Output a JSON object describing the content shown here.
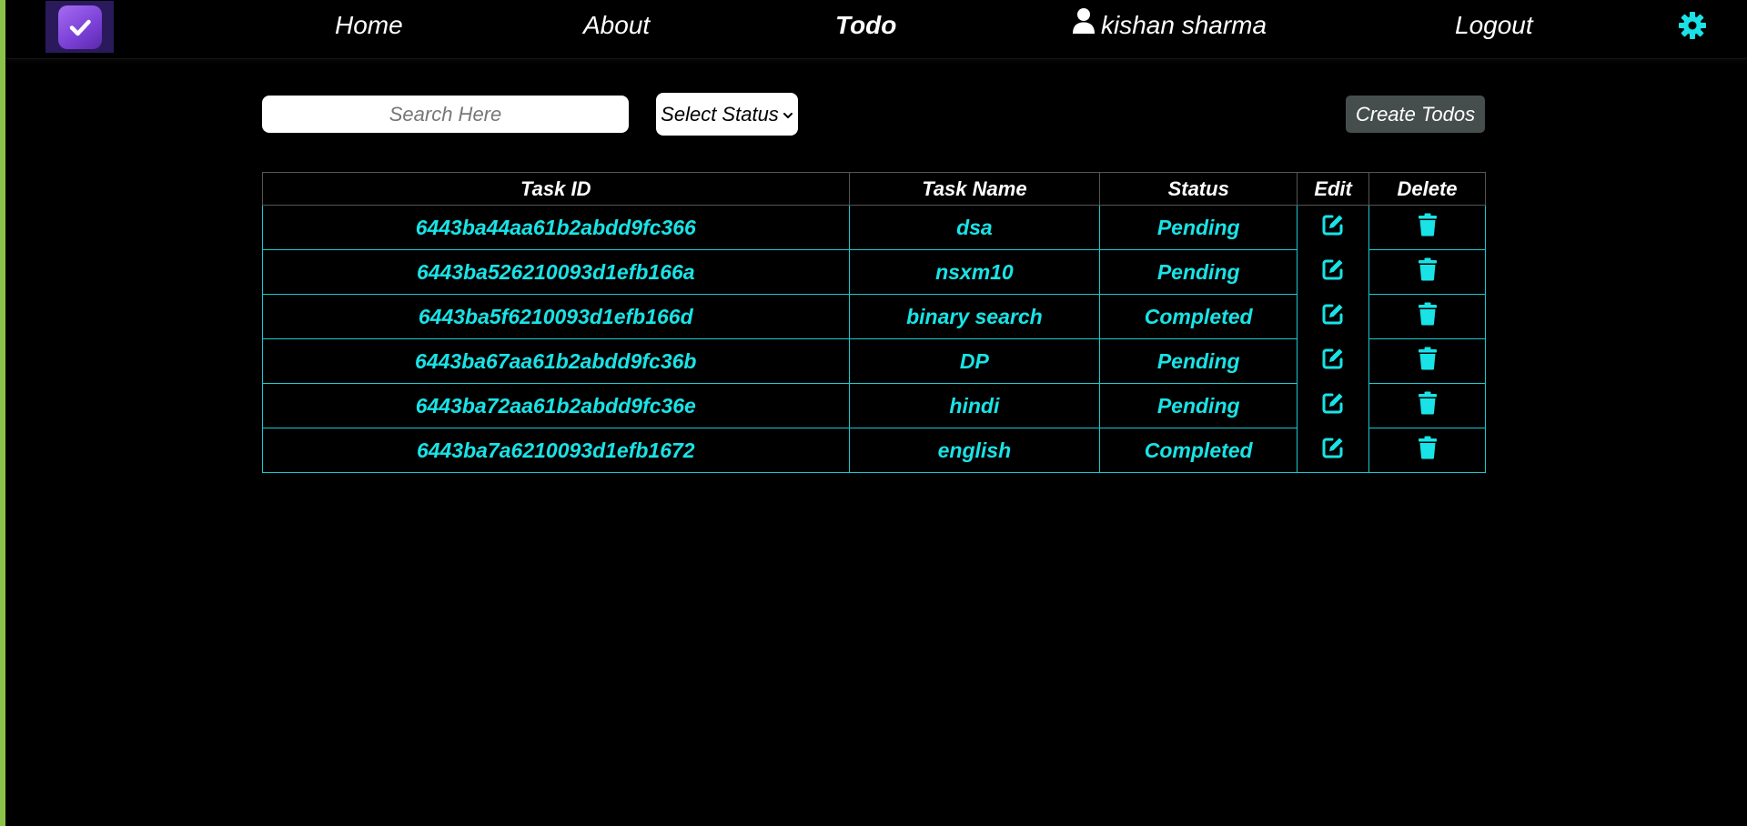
{
  "nav": {
    "home": "Home",
    "about": "About",
    "todo": "Todo",
    "user": "kishan sharma",
    "logout": "Logout"
  },
  "toolbar": {
    "search_placeholder": "Search Here",
    "status_select": "Select Status",
    "create_button": "Create Todos"
  },
  "table": {
    "headers": {
      "id": "Task ID",
      "name": "Task Name",
      "status": "Status",
      "edit": "Edit",
      "delete": "Delete"
    },
    "rows": [
      {
        "id": "6443ba44aa61b2abdd9fc366",
        "name": "dsa",
        "status": "Pending"
      },
      {
        "id": "6443ba526210093d1efb166a",
        "name": "nsxm10",
        "status": "Pending"
      },
      {
        "id": "6443ba5f6210093d1efb166d",
        "name": "binary search",
        "status": "Completed"
      },
      {
        "id": "6443ba67aa61b2abdd9fc36b",
        "name": "DP",
        "status": "Pending"
      },
      {
        "id": "6443ba72aa61b2abdd9fc36e",
        "name": "hindi",
        "status": "Pending"
      },
      {
        "id": "6443ba7a6210093d1efb1672",
        "name": "english",
        "status": "Completed"
      }
    ]
  },
  "colors": {
    "accent": "#19e3e6",
    "background": "#000000",
    "left_border": "#8bc34a",
    "create_button": "#464d4d",
    "logo": "#7a3fd6"
  },
  "icons": {
    "logo": "checkbox-check-icon",
    "user": "user-icon",
    "theme": "gear-icon",
    "edit": "edit-icon",
    "delete": "trash-icon",
    "select": "chevron-down-icon"
  }
}
